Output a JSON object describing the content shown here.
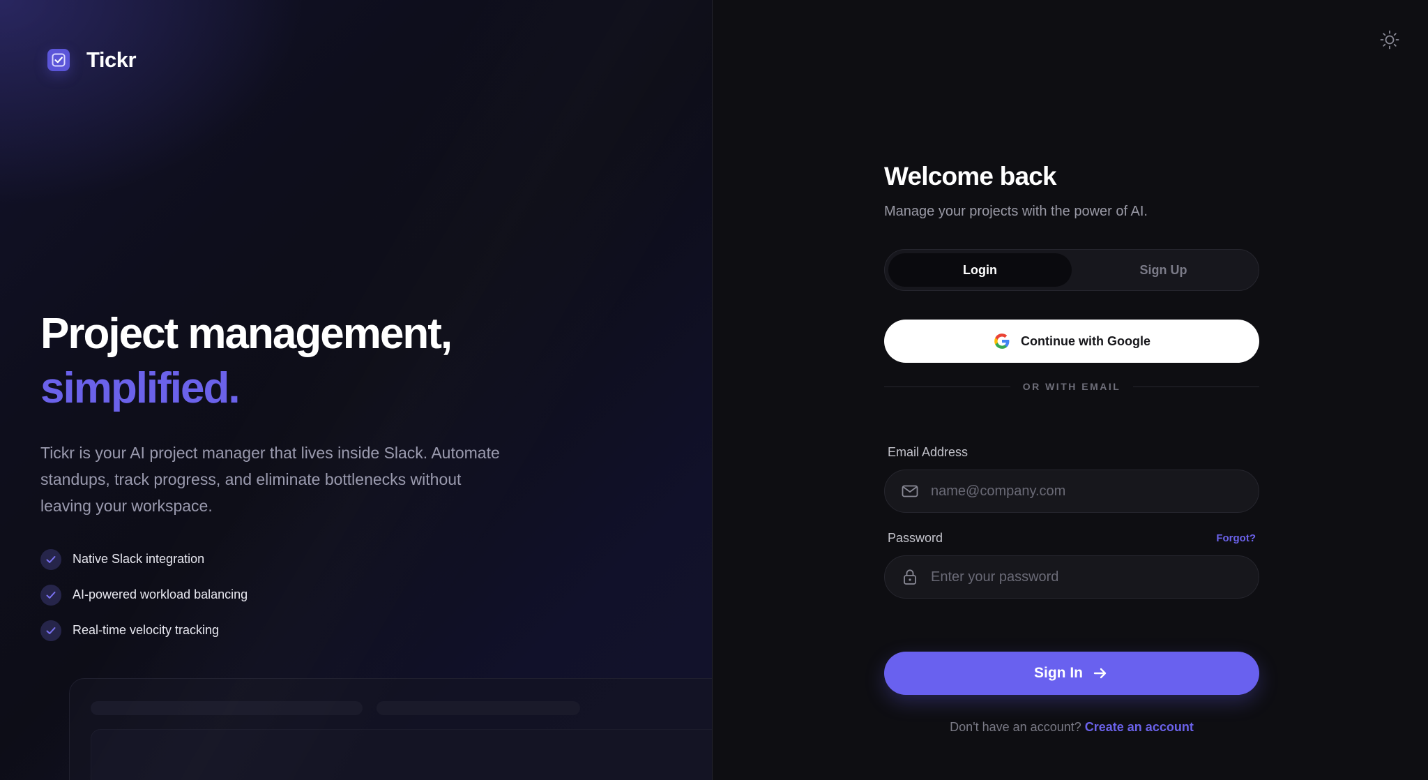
{
  "brand": {
    "name": "Tickr",
    "icon": "checkbox-icon",
    "accent": "#5b55d8"
  },
  "hero": {
    "title_line1": "Project management,",
    "title_line2": "simplified.",
    "description": "Tickr is your AI project manager that lives inside Slack. Automate standups, track progress, and eliminate bottlenecks without leaving your workspace."
  },
  "features": [
    {
      "label": "Native Slack integration"
    },
    {
      "label": "AI-powered workload balancing"
    },
    {
      "label": "Real-time velocity tracking"
    }
  ],
  "auth": {
    "title": "Welcome back",
    "subtitle": "Manage your projects with the power of AI.",
    "tabs": [
      {
        "label": "Login",
        "active": true
      },
      {
        "label": "Sign Up",
        "active": false
      }
    ],
    "google_label": "Continue with Google",
    "divider": "OR WITH EMAIL",
    "email": {
      "label": "Email Address",
      "placeholder": "name@company.com",
      "value": ""
    },
    "password": {
      "label": "Password",
      "placeholder": "Enter your password",
      "value": "",
      "forgot": "Forgot?"
    },
    "signin_label": "Sign In",
    "footer_text": "Don't have an account?",
    "footer_link": "Create an account"
  },
  "colors": {
    "primary": "#6961ef",
    "accent_text": "#6b62ea",
    "background": "#0e0e12"
  }
}
